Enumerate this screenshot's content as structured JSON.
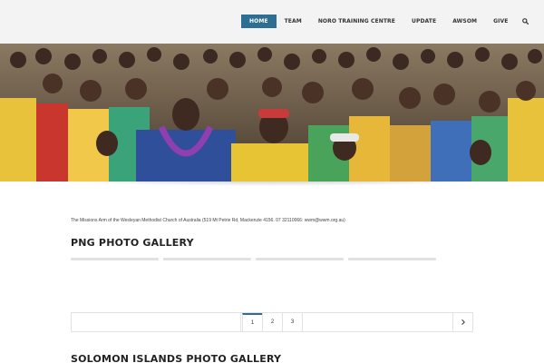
{
  "nav": {
    "items": [
      {
        "label": "HOME",
        "active": true
      },
      {
        "label": "TEAM"
      },
      {
        "label": "NORO TRAINING CENTRE"
      },
      {
        "label": "UPDATE"
      },
      {
        "label": "AWSOM"
      },
      {
        "label": "GIVE"
      }
    ],
    "search_icon": "search-icon",
    "active_color": "#2d6f93"
  },
  "hero": {
    "image": "crowd-photo"
  },
  "content": {
    "subtitle": "The Missions Arm of the Wesleyan Methodist Church of Australia (519 Mt Petrie Rd, Mackenzie 4156. 07 32110066: wwm@wwm.org.au)",
    "gallery_title": "PNG PHOTO GALLERY",
    "second_title": "SOLOMON ISLANDS PHOTO GALLERY"
  },
  "pagination": {
    "pages": [
      "1",
      "2",
      "3"
    ],
    "current": "1",
    "next_icon": "chevron-right-icon"
  }
}
